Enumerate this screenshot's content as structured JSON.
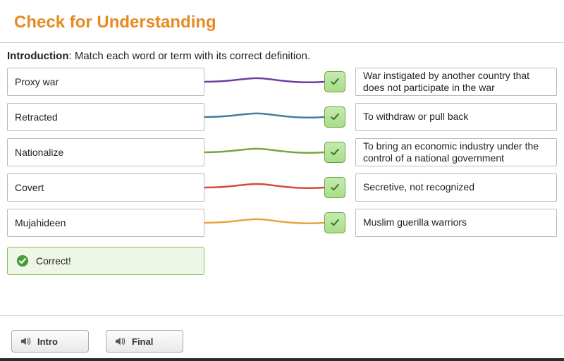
{
  "header": {
    "title": "Check for Understanding"
  },
  "intro": {
    "label": "Introduction",
    "text": ": Match each word or term with its correct definition."
  },
  "pairs": [
    {
      "term": "Proxy war",
      "definition": "War instigated by another country that does not participate in the war",
      "color": "#6a3f9c"
    },
    {
      "term": "Retracted",
      "definition": "To withdraw or pull back",
      "color": "#3e7f9c"
    },
    {
      "term": "Nationalize",
      "definition": "To bring an economic industry under the control of a national government",
      "color": "#7ea23f"
    },
    {
      "term": "Covert",
      "definition": "Secretive, not recognized",
      "color": "#d9483b"
    },
    {
      "term": "Mujahideen",
      "definition": "Muslim guerilla warriors",
      "color": "#e9a23b"
    }
  ],
  "feedback": {
    "text": "Correct!"
  },
  "footer": {
    "intro_btn": "Intro",
    "final_btn": "Final"
  }
}
